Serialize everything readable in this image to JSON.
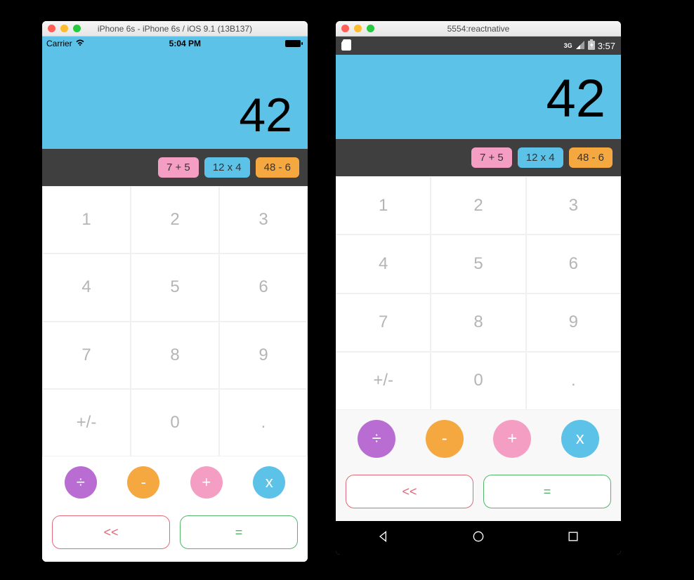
{
  "ios": {
    "window_title": "iPhone 6s - iPhone 6s / iOS 9.1 (13B137)",
    "carrier": "Carrier",
    "time": "5:04 PM",
    "display": "42",
    "history": [
      {
        "text": "7 + 5",
        "color": "pink"
      },
      {
        "text": "12 x 4",
        "color": "blue"
      },
      {
        "text": "48 - 6",
        "color": "orange"
      }
    ],
    "numpad": [
      "1",
      "2",
      "3",
      "4",
      "5",
      "6",
      "7",
      "8",
      "9",
      "+/-",
      "0",
      "."
    ],
    "ops": [
      {
        "label": "÷",
        "color": "purple"
      },
      {
        "label": "-",
        "color": "orange"
      },
      {
        "label": "+",
        "color": "pink"
      },
      {
        "label": "x",
        "color": "blue"
      }
    ],
    "back_label": "<<",
    "equals_label": "="
  },
  "android": {
    "window_title": "5554:reactnative",
    "network": "3G",
    "time": "3:57",
    "display": "42",
    "history": [
      {
        "text": "7 + 5",
        "color": "pink"
      },
      {
        "text": "12 x 4",
        "color": "blue"
      },
      {
        "text": "48 - 6",
        "color": "orange"
      }
    ],
    "numpad": [
      "1",
      "2",
      "3",
      "4",
      "5",
      "6",
      "7",
      "8",
      "9",
      "+/-",
      "0",
      "."
    ],
    "ops": [
      {
        "label": "÷",
        "color": "purple"
      },
      {
        "label": "-",
        "color": "orange"
      },
      {
        "label": "+",
        "color": "pink"
      },
      {
        "label": "x",
        "color": "blue"
      }
    ],
    "back_label": "<<",
    "equals_label": "="
  },
  "colors": {
    "display_bg": "#5cc2e8",
    "history_bg": "#3f3f3f",
    "pink": "#f59ec4",
    "blue": "#5cc2e8",
    "orange": "#f5a840",
    "purple": "#b96dd3",
    "back_red": "#e06a7a",
    "equals_green": "#52b56a"
  }
}
